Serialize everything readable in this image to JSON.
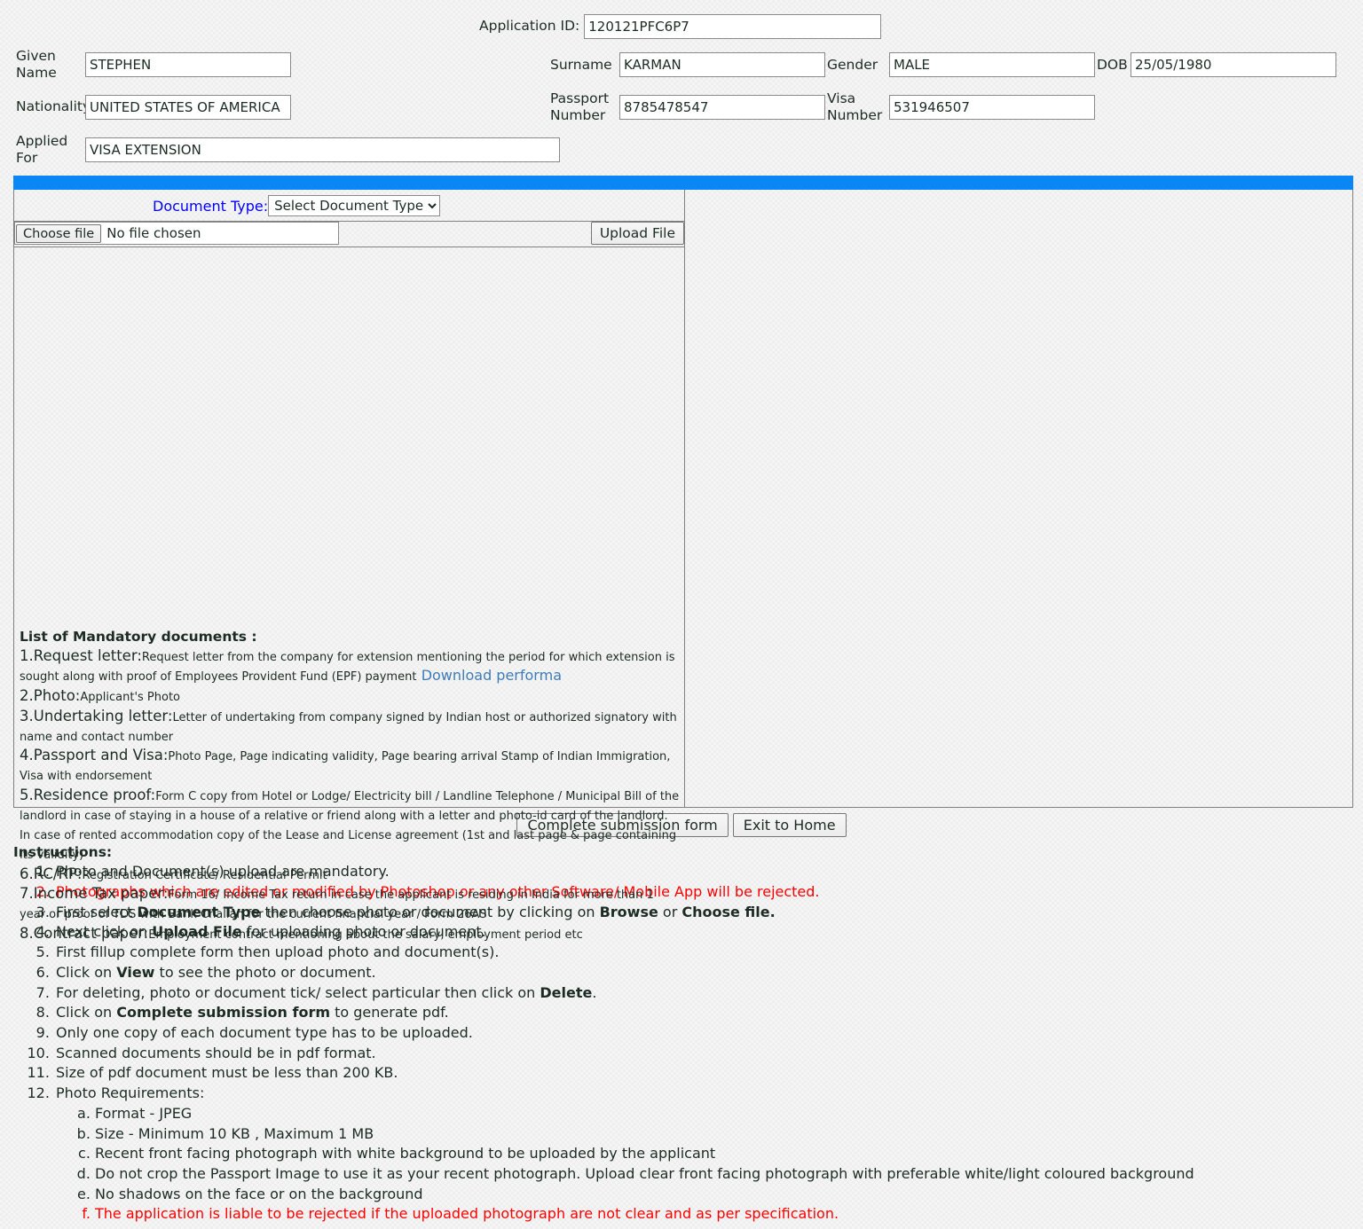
{
  "header": {
    "application_id_label": "Application ID:",
    "application_id_value": "120121PFC6P7",
    "given_name_label": "Given Name",
    "given_name_value": "STEPHEN",
    "surname_label": "Surname",
    "surname_value": "KARMAN",
    "gender_label": "Gender",
    "gender_value": "MALE",
    "dob_label": "DOB",
    "dob_value": "25/05/1980",
    "nationality_label": "Nationality",
    "nationality_value": "UNITED STATES OF AMERICA",
    "passport_label": "Passport Number",
    "passport_value": "8785478547",
    "visa_label": "Visa Number",
    "visa_value": "531946507",
    "applied_for_label": "Applied For",
    "applied_for_value": "VISA EXTENSION"
  },
  "upload": {
    "document_type_label": "Document Type:",
    "document_type_selected": "Select Document Type",
    "document_type_options": [
      "Select Document Type"
    ],
    "choose_file_label": "Choose file",
    "no_file_chosen": "No file chosen",
    "upload_file_label": "Upload File"
  },
  "doclist": {
    "title": "List of Mandatory documents :",
    "items": [
      {
        "name": "1.Request letter:",
        "desc": "Request letter from the company for extension mentioning the period for which extension is sought along with proof of Employees Provident Fund (EPF) payment",
        "link": "Download performa"
      },
      {
        "name": "2.Photo:",
        "desc": "Applicant's Photo"
      },
      {
        "name": "3.Undertaking letter:",
        "desc": "Letter of undertaking from company signed by Indian host or authorized signatory with name and contact number"
      },
      {
        "name": "4.Passport and Visa:",
        "desc": "Photo Page, Page indicating validity, Page bearing arrival Stamp of Indian Immigration, Visa with endorsement"
      },
      {
        "name": "5.Residence proof:",
        "desc": "Form C copy from Hotel or Lodge/ Electricity bill / Landline Telephone / Municipal Bill of the landlord in case of staying in a house of a relative or friend along with a letter and photo-id card of the landlord. In case of rented accommodation copy of the Lease and License agreement (1st and last page & page containing its validity)"
      },
      {
        "name": "6.RC/RP:",
        "desc": "Registration Certificate/ Residential Permit"
      },
      {
        "name": "7.Income Tax paper:",
        "desc": "Form 16/ Income Tax return in case the applicant is residing in India for more than 1 year or proof of TDS with Bank Challan for the current financial year / Form 26AS"
      },
      {
        "name": "8.Contract paper:",
        "desc": "Employment contract mentioning about the salary, employment period etc"
      }
    ]
  },
  "actions": {
    "complete_submission_label": "Complete submission form",
    "exit_to_home_label": "Exit to Home"
  },
  "instructions": {
    "title": "Instructions:",
    "items": [
      {
        "text": "Photo and Document(s) upload are mandatory.",
        "red": false
      },
      {
        "text": "Photographs which are edited or modified by Photoshop or any other Software/ Mobile App will be rejected.",
        "red": true
      },
      {
        "html": "First select <b>Document Type</b> then choose photo or document by clicking on <b>Browse</b> or <b>Choose file.</b>",
        "red": false
      },
      {
        "html": "Next click on <b>Upload File</b> for uploading photo or document.",
        "red": false
      },
      {
        "text": "First fillup complete form then upload photo and document(s).",
        "red": false
      },
      {
        "html": "Click on <b>View</b> to see the photo or document.",
        "red": false
      },
      {
        "html": "For deleting, photo or document tick/ select particular then click on <b>Delete</b>.",
        "red": false
      },
      {
        "html": "Click on <b>Complete submission form</b> to generate pdf.",
        "red": false
      },
      {
        "text": "Only one copy of each document type has to be uploaded.",
        "red": false
      },
      {
        "text": "Scanned documents should be in pdf format.",
        "red": false
      },
      {
        "text": "Size of pdf document must be less than 200 KB.",
        "red": false
      },
      {
        "text": "Photo Requirements:",
        "red": false,
        "sub": [
          {
            "text": "Format - JPEG",
            "red": false
          },
          {
            "text": "Size - Minimum 10 KB , Maximum 1 MB",
            "red": false
          },
          {
            "text": "Recent front facing photograph with white background to be uploaded by the applicant",
            "red": false
          },
          {
            "text": "Do not crop the Passport Image to use it as your recent photograph. Upload clear front facing photograph with preferable white/light coloured background",
            "red": false
          },
          {
            "text": "No shadows on the face or on the background",
            "red": false
          },
          {
            "text": "The application is liable to be rejected if the uploaded photograph are not clear and as per specification.",
            "red": true
          }
        ]
      }
    ]
  },
  "colors": {
    "blue_bar": "#0b86f5",
    "doc_type_label": "#0000ff",
    "link": "#3d7cb8",
    "warning_red": "#ff0000",
    "page_background": "#eeeeee"
  }
}
